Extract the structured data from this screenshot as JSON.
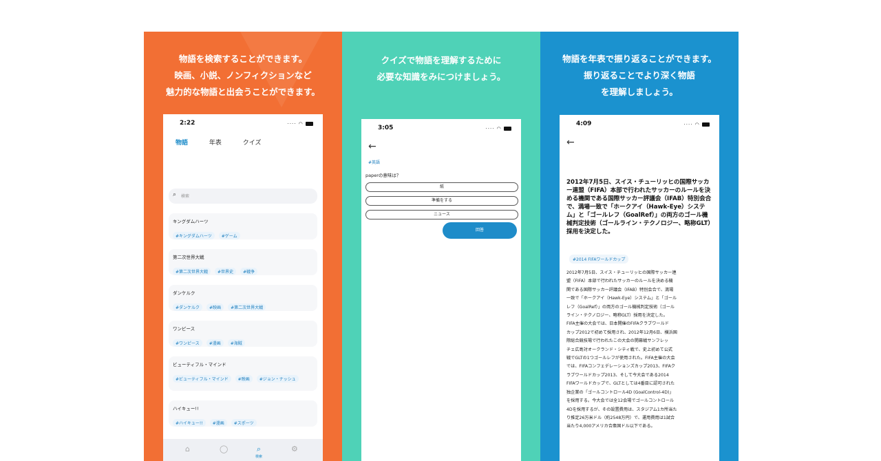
{
  "panels": [
    {
      "caption": [
        "物語を検索することができます。",
        "映画、小説、ノンフィクションなど",
        "魅力的な物語と出会うことができます。"
      ],
      "phone": {
        "time": "2:22",
        "tabs": [
          "物語",
          "年表",
          "クイズ"
        ],
        "search_placeholder": "検索",
        "items": [
          {
            "title": "キングダムハーツ",
            "tags": [
              "#キングダムハーツ",
              "#ゲーム"
            ]
          },
          {
            "title": "第二次世界大戦",
            "tags": [
              "#第二次世界大戦",
              "#世界史",
              "#戦争"
            ]
          },
          {
            "title": "ダンケルク",
            "tags": [
              "#ダンケルク",
              "#映画",
              "#第二次世界大戦"
            ]
          },
          {
            "title": "ワンピース",
            "tags": [
              "#ワンピース",
              "#漫画",
              "#海賊"
            ]
          },
          {
            "title": "ビューティフル・マインド",
            "tags": [
              "#ビューティフル・マインド",
              "#映画",
              "#ジョン・ナッシュ"
            ]
          },
          {
            "title": "ハイキュー!!",
            "tags": [
              "#ハイキュー!!",
              "#漫画",
              "#スポーツ"
            ]
          }
        ],
        "tabbar": {
          "search_label": "検索"
        }
      }
    },
    {
      "caption": [
        "クイズで物語を理解するために",
        "必要な知識をみにつけましょう。"
      ],
      "phone": {
        "time": "3:05",
        "tag": "#英語",
        "question": "paperの意味は？",
        "options": [
          "紙",
          "準備をする",
          "ニュース"
        ],
        "answer_button": "回答"
      }
    },
    {
      "caption": [
        "物語を年表で振り返ることができます。",
        "振り返ることでより深く物語",
        "を理解しましょう。"
      ],
      "phone": {
        "time": "4:09",
        "headline": "2012年7月5日、スイス・チューリッヒの国際サッカー連盟（FIFA）本部で行われたサッカーのルールを決める機関である国際サッカー評議会（IFAB）特別会合で、満場一致で「ホークアイ（Hawk-Eye）システム」と「ゴールレフ（GoalRef）」の両方のゴール機械判定技術（ゴールライン・テクノロジー、略称GLT）採用を決定した。",
        "chip": "#2014 FIFAワールドカップ",
        "body_lines": [
          "2012年7月5日、スイス・チューリッヒの国際サッカー連",
          "盟（FIFA）本部で行われたサッカーのルールを決める機",
          "関である国際サッカー評議会（IFAB）特別会合で、満場",
          "一致で「ホークアイ（Hawk-Eye）システム」と「ゴール",
          "レフ（GoalRef）」の両方のゴール機械判定技術（ゴール",
          "ライン・テクノロジー、略称GLT）採用を決定した。",
          "FIFA主催の大会では、日本開催のFIFAクラブワールド",
          "カップ2012で初めて採用され、2012年12月6日、横浜国",
          "際総合競技場で行われたこの大会の開幕戦サンフレッ",
          "チェ広島対オークランド・シティ戦で、史上初めて公式",
          "戦でGLTの1つゴールレフが使用された。FIFA主催の大会",
          "では、FIFAコンフェデレーションズカップ2013、FIFAク",
          "ラブワールドカップ2013、そして今大会である2014",
          "FIFAワールドカップで、GLTとしては4番目に認可された",
          "独企業の「ゴールコントロール4D (GoalControl-4D)」",
          "を採用する。今大会では全12会場でゴールコントロール",
          "4Dを採用するが、その設置費用は、スタジアム1カ所当た",
          "り推定26万米ドル（約2548万円）で、運用費用は1試合",
          "当たり4,000アメリカ合衆国ドル以下である。"
        ]
      }
    }
  ]
}
